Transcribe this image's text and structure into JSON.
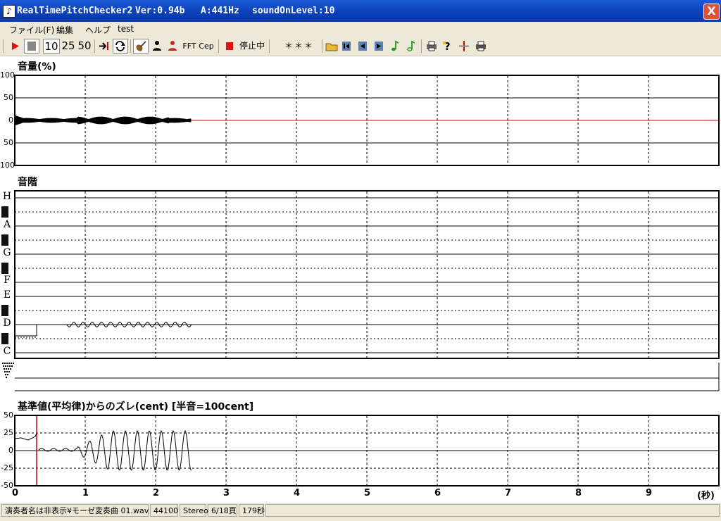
{
  "window": {
    "app_name": "RealTimePitchChecker2",
    "version": "Ver:0.94b",
    "a_freq": "A:441Hz",
    "sound_on_level": "soundOnLevel:10",
    "close_glyph": "X",
    "icon_glyph": "♪"
  },
  "menu": {
    "file": "ファイル(F)",
    "edit": "編集",
    "help": "ヘルプ",
    "test": "test"
  },
  "toolbar": {
    "play_icon": "play-icon",
    "stop_icon": "stop-icon",
    "zoom_10": "10",
    "zoom_25": "25",
    "zoom_50": "50",
    "fft_label": "FFT",
    "cep_label": "Cep",
    "status_label": "停止中",
    "value_display": "＊＊＊"
  },
  "volume": {
    "title": "音量(%)",
    "ticks": [
      "100",
      "50",
      "0",
      "50",
      "100"
    ]
  },
  "pitch": {
    "title": "音階",
    "notes": [
      "H",
      "A",
      "G",
      "F",
      "E",
      "D",
      "C"
    ]
  },
  "deviation": {
    "title": "基準値(平均律)からのズレ(cent) [半音=100cent]",
    "ticks": [
      "50",
      "25",
      "0",
      "-25",
      "-50"
    ]
  },
  "time_axis": {
    "ticks": [
      "0",
      "1",
      "2",
      "3",
      "4",
      "5",
      "6",
      "7",
      "8",
      "9"
    ],
    "unit": "(秒)"
  },
  "statusbar": {
    "file": "演奏者名は非表示¥モーゼ変奏曲 01.wav",
    "sample_rate": "44100",
    "channels": "Stereo",
    "page": "6/18頁",
    "duration": "179秒"
  },
  "colors": {
    "titlebar": "#0a3fb6",
    "signal_red": "#cc0000",
    "chrome": "#ece9d8"
  }
}
